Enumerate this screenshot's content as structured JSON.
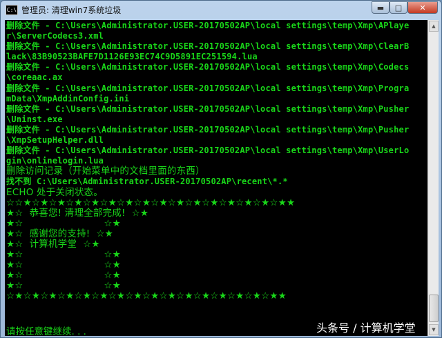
{
  "window": {
    "icon_text": "C:\\",
    "title": "管理员:  清理win7系统垃圾",
    "minimize": "▬",
    "maximize": "□",
    "close": "✕"
  },
  "console": {
    "lines": [
      {
        "text": "删除文件 - C:\\Users\\Administrator.USER-20170502AP\\local settings\\temp\\Xmp\\APlaye",
        "cn": false
      },
      {
        "text": "r\\ServerCodecs3.xml",
        "cn": false
      },
      {
        "text": "删除文件 - C:\\Users\\Administrator.USER-20170502AP\\local settings\\temp\\Xmp\\ClearB",
        "cn": false
      },
      {
        "text": "lack\\83B90523BAFE7D1126E93EC74C9D5891EC251594.lua",
        "cn": false
      },
      {
        "text": "删除文件 - C:\\Users\\Administrator.USER-20170502AP\\local settings\\temp\\Xmp\\Codecs",
        "cn": false
      },
      {
        "text": "\\coreaac.ax",
        "cn": false
      },
      {
        "text": "删除文件 - C:\\Users\\Administrator.USER-20170502AP\\local settings\\temp\\Xmp\\Progra",
        "cn": false
      },
      {
        "text": "mData\\XmpAddinConfig.ini",
        "cn": false
      },
      {
        "text": "删除文件 - C:\\Users\\Administrator.USER-20170502AP\\local settings\\temp\\Xmp\\Pusher",
        "cn": false
      },
      {
        "text": "\\Uninst.exe",
        "cn": false
      },
      {
        "text": "删除文件 - C:\\Users\\Administrator.USER-20170502AP\\local settings\\temp\\Xmp\\Pusher",
        "cn": false
      },
      {
        "text": "\\XmpSetupHelper.dll",
        "cn": false
      },
      {
        "text": "删除文件 - C:\\Users\\Administrator.USER-20170502AP\\local settings\\temp\\Xmp\\UserLo",
        "cn": false
      },
      {
        "text": "gin\\onlinelogin.lua",
        "cn": false
      },
      {
        "text": "删除访问记录（开始菜单中的文档里面的东西）",
        "cn": true
      },
      {
        "text": "找不到 C:\\Users\\Administrator.USER-20170502AP\\recent\\*.*",
        "cn": false
      },
      {
        "text": "ECHO 处于关闭状态。",
        "cn": true
      },
      {
        "text": "☆☆★☆★☆★☆★☆★☆★☆★☆★☆★☆★☆★☆★☆★☆★☆★☆★★",
        "cn": true
      },
      {
        "text": "★☆  恭喜您! 清理全部完成!  ☆★",
        "cn": true
      },
      {
        "text": "★☆                          ☆★",
        "cn": true
      },
      {
        "text": "★☆  感谢您的支持!  ☆★",
        "cn": true
      },
      {
        "text": "★☆  计算机学堂  ☆★",
        "cn": true
      },
      {
        "text": "★☆                          ☆★",
        "cn": true
      },
      {
        "text": "★☆                          ☆★",
        "cn": true
      },
      {
        "text": "★☆                          ☆★",
        "cn": true
      },
      {
        "text": "★☆                          ☆★",
        "cn": true
      },
      {
        "text": "☆★☆★☆★☆★☆★☆★☆★☆★☆★☆★☆★☆★☆★☆★☆★☆★★",
        "cn": true
      }
    ],
    "prompt": "请按任意键继续. . ."
  },
  "scrollbar": {
    "up": "▲",
    "down": "▼"
  },
  "watermark": "头条号 / 计算机学堂",
  "colors": {
    "console_text": "#19d619",
    "console_bg": "#000000",
    "title_bar": "#bcd3ec"
  }
}
